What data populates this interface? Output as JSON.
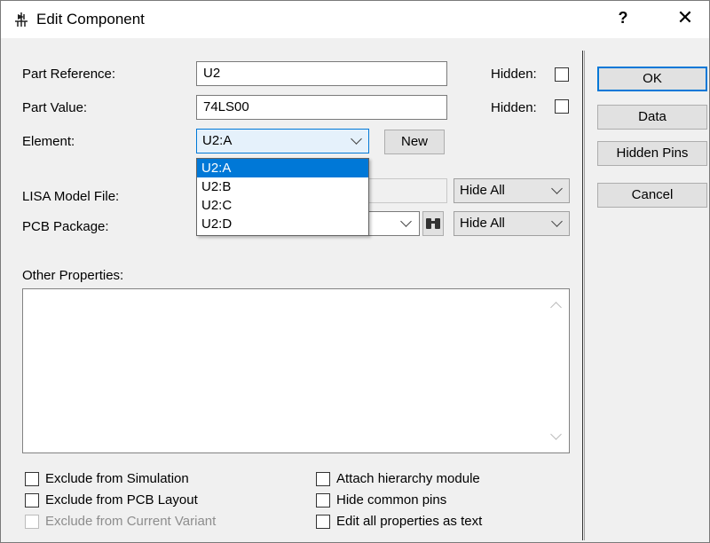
{
  "window": {
    "title": "Edit Component",
    "help_label": "?",
    "close_label": "✕"
  },
  "fields": {
    "part_reference": {
      "label": "Part Reference:",
      "value": "U2",
      "hidden_label": "Hidden:",
      "hidden_checked": false
    },
    "part_value": {
      "label": "Part Value:",
      "value": "74LS00",
      "hidden_label": "Hidden:",
      "hidden_checked": false
    },
    "element": {
      "label": "Element:",
      "value": "U2:A",
      "options": [
        "U2:A",
        "U2:B",
        "U2:C",
        "U2:D"
      ],
      "new_button": "New"
    },
    "lisa_model_file": {
      "label": "LISA Model File:",
      "value": "",
      "visibility": "Hide All"
    },
    "pcb_package": {
      "label": "PCB Package:",
      "value": "",
      "visibility": "Hide All"
    },
    "other_properties": {
      "label": "Other Properties:",
      "value": ""
    }
  },
  "buttons": {
    "ok": "OK",
    "data": "Data",
    "hidden_pins": "Hidden Pins",
    "cancel": "Cancel"
  },
  "options_left": [
    {
      "label": "Exclude from Simulation",
      "checked": false,
      "enabled": true
    },
    {
      "label": "Exclude from PCB Layout",
      "checked": false,
      "enabled": true
    },
    {
      "label": "Exclude from Current Variant",
      "checked": false,
      "enabled": false
    }
  ],
  "options_right": [
    {
      "label": "Attach hierarchy module",
      "checked": false,
      "enabled": true
    },
    {
      "label": "Hide common pins",
      "checked": false,
      "enabled": true
    },
    {
      "label": "Edit all properties as text",
      "checked": false,
      "enabled": true
    }
  ],
  "colors": {
    "accent": "#0078d7",
    "selection": "#0078d7"
  }
}
